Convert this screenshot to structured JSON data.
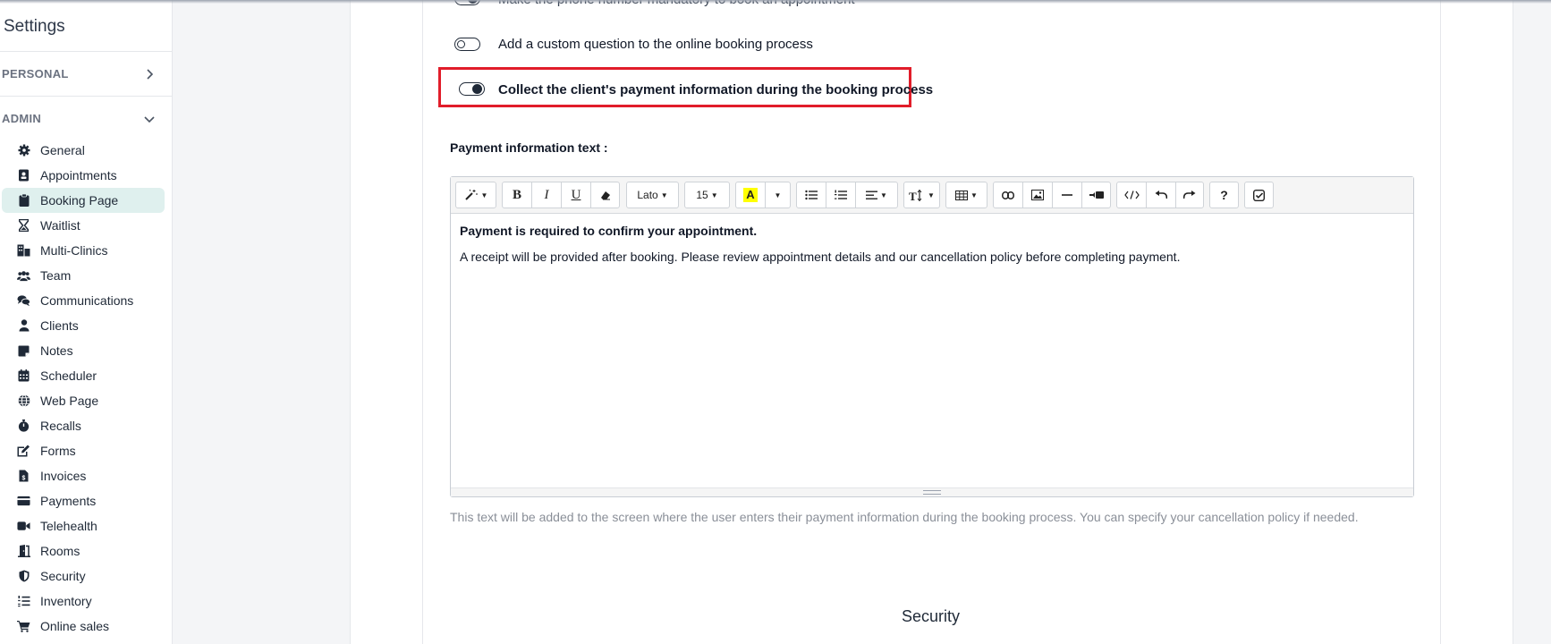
{
  "sidebar": {
    "title": "Settings",
    "sections": [
      {
        "label": "PERSONAL",
        "chevron": "chevron-right-icon"
      },
      {
        "label": "ADMIN",
        "chevron": "chevron-down-icon"
      }
    ],
    "items": [
      {
        "label": "General",
        "icon": "gear-icon"
      },
      {
        "label": "Appointments",
        "icon": "address-card-icon"
      },
      {
        "label": "Booking Page",
        "icon": "clipboard-icon",
        "active": true
      },
      {
        "label": "Waitlist",
        "icon": "hourglass-icon"
      },
      {
        "label": "Multi-Clinics",
        "icon": "clinic-building-icon"
      },
      {
        "label": "Team",
        "icon": "users-icon"
      },
      {
        "label": "Communications",
        "icon": "chat-bubbles-icon"
      },
      {
        "label": "Clients",
        "icon": "user-icon"
      },
      {
        "label": "Notes",
        "icon": "sticky-note-icon"
      },
      {
        "label": "Scheduler",
        "icon": "calendar-icon"
      },
      {
        "label": "Web Page",
        "icon": "globe-icon"
      },
      {
        "label": "Recalls",
        "icon": "stopwatch-icon"
      },
      {
        "label": "Forms",
        "icon": "form-edit-icon"
      },
      {
        "label": "Invoices",
        "icon": "invoice-dollar-icon"
      },
      {
        "label": "Payments",
        "icon": "credit-card-icon"
      },
      {
        "label": "Telehealth",
        "icon": "video-camera-icon"
      },
      {
        "label": "Rooms",
        "icon": "door-icon"
      },
      {
        "label": "Security",
        "icon": "shield-icon"
      },
      {
        "label": "Inventory",
        "icon": "list-ol-icon"
      },
      {
        "label": "Online sales",
        "icon": "shopping-cart-icon"
      }
    ]
  },
  "main": {
    "cut_toggle_label": "Make the phone number mandatory to book an appointment",
    "toggles": [
      {
        "label": "Add a custom question to the online booking process",
        "state": "off"
      },
      {
        "label": "Collect the client's payment information during the booking process",
        "state": "on"
      }
    ],
    "payment_label": "Payment information text :",
    "editor": {
      "font_family": "Lato",
      "font_size": "15",
      "paragraph_1": "Payment is required to confirm your appointment.",
      "paragraph_2": "A receipt will be provided after booking. Please review appointment details and our cancellation policy before completing payment."
    },
    "help_text": "This text will be added to the screen where the user enters their payment information during the booking process. You can specify your cancellation policy if needed.",
    "next_section_heading": "Security"
  },
  "colors": {
    "active_nav_bg": "#dff0ee",
    "highlight_border": "#e11d2a",
    "highlighter_yellow": "#ffff00"
  }
}
